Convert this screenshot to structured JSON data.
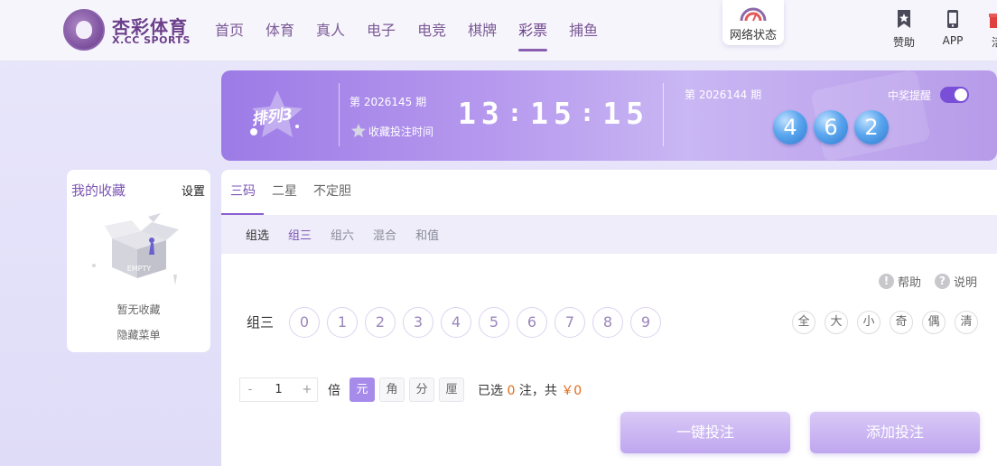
{
  "header": {
    "logo_cn": "杏彩体育",
    "logo_en": "X.CC SPORTS",
    "nav": [
      "首页",
      "体育",
      "真人",
      "电子",
      "电竞",
      "棋牌",
      "彩票",
      "捕鱼"
    ],
    "active_nav": "彩票",
    "network_status": "网络状态",
    "sponsor": "赞助",
    "app": "APP",
    "cut_off": "活"
  },
  "banner": {
    "lottery_name": "排列3",
    "current_issue": "第 2026145 期",
    "fav_time_label": "收藏投注时间",
    "countdown": {
      "h": "13",
      "m": "15",
      "s": "15",
      "sep": ":"
    },
    "prev_issue": "第 2026144 期",
    "remind_label": "中奖提醒",
    "remind_on": true,
    "result_balls": [
      "4",
      "6",
      "2"
    ]
  },
  "favorites": {
    "title": "我的收藏",
    "settings": "设置",
    "empty_text": "暂无收藏",
    "hide_menu": "隐藏菜单",
    "empty_badge": "EMPTY"
  },
  "main": {
    "tabs": [
      "三码",
      "二星",
      "不定胆"
    ],
    "subtab_label": "组选",
    "subtabs": [
      "组三",
      "组六",
      "混合",
      "和值"
    ],
    "help": "帮助",
    "explain": "说明",
    "pick_label": "组三",
    "digits": [
      "0",
      "1",
      "2",
      "3",
      "4",
      "5",
      "6",
      "7",
      "8",
      "9"
    ],
    "quick": [
      "全",
      "大",
      "小",
      "奇",
      "偶",
      "清"
    ],
    "stepper": {
      "minus": "-",
      "value": "1",
      "plus": "+"
    },
    "multiple_label": "倍",
    "units": [
      "元",
      "角",
      "分",
      "厘"
    ],
    "summary_prefix": "已选",
    "summary_count": "0",
    "summary_mid": "注，共",
    "summary_amount": "￥0",
    "btn_quick_bet": "一键投注",
    "btn_add_bet": "添加投注"
  },
  "colors": {
    "accent": "#8a5fd1",
    "banner_start": "#9c7be6",
    "ball_blue": "#2f7ad1",
    "amount": "#e26b18"
  }
}
